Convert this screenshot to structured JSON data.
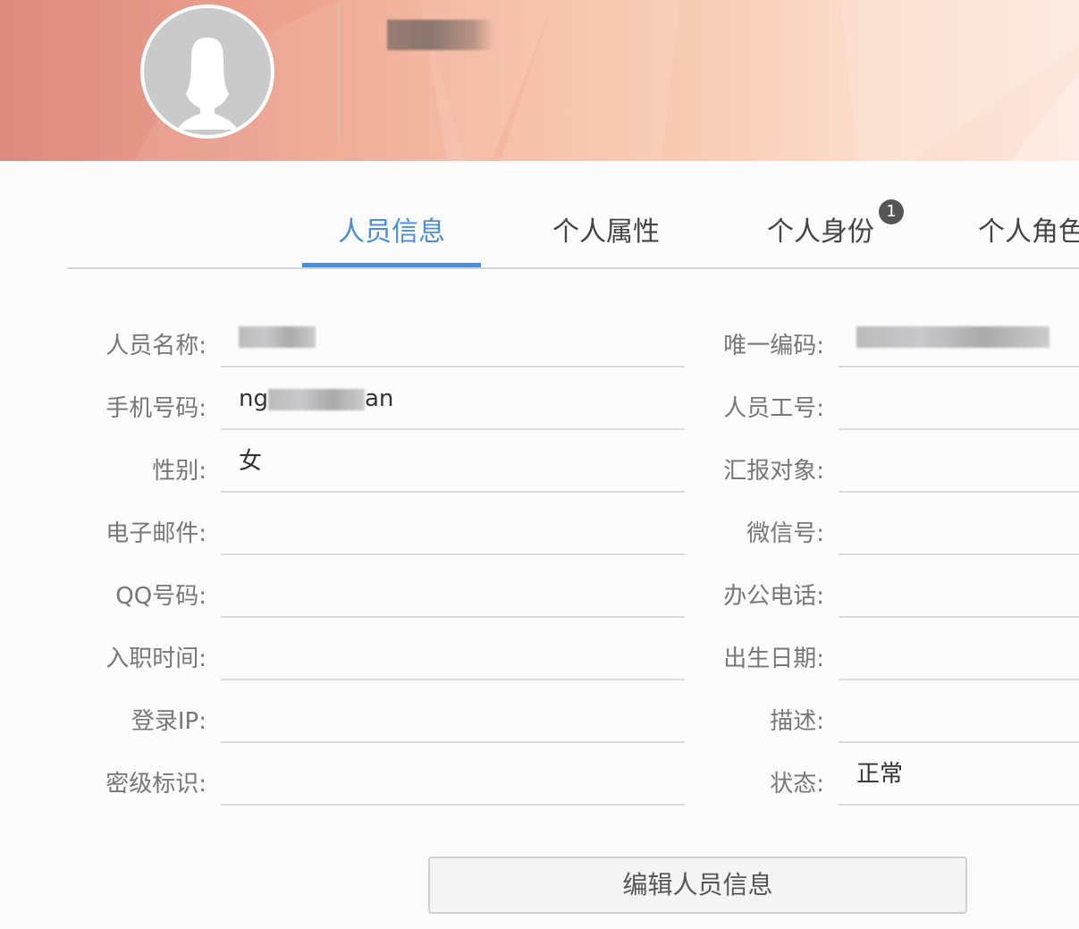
{
  "header": {
    "avatar": "female-avatar-placeholder"
  },
  "tabs": [
    {
      "label": "人员信息",
      "active": true
    },
    {
      "label": "个人属性"
    },
    {
      "label": "个人身份",
      "badge": "1"
    },
    {
      "label": "个人角色"
    }
  ],
  "left_fields": [
    {
      "label": "人员名称:",
      "value": ""
    },
    {
      "label": "手机号码:",
      "value_prefix": "ng",
      "value_suffix": "an"
    },
    {
      "label": "性别:",
      "value": "女"
    },
    {
      "label": "电子邮件:",
      "value": ""
    },
    {
      "label": "QQ号码:",
      "value": ""
    },
    {
      "label": "入职时间:",
      "value": ""
    },
    {
      "label": "登录IP:",
      "value": ""
    },
    {
      "label": "密级标识:",
      "value": ""
    }
  ],
  "right_fields": [
    {
      "label": "唯一编码:",
      "value": ""
    },
    {
      "label": "人员工号:",
      "value": ""
    },
    {
      "label": "汇报对象:",
      "value": ""
    },
    {
      "label": "微信号:",
      "value": ""
    },
    {
      "label": "办公电话:",
      "value": ""
    },
    {
      "label": "出生日期:",
      "value": ""
    },
    {
      "label": "描述:",
      "value": ""
    },
    {
      "label": "状态:",
      "value": "正常"
    }
  ],
  "edit_button": "编辑人员信息",
  "colors": {
    "accent": "#4a8ee0"
  }
}
